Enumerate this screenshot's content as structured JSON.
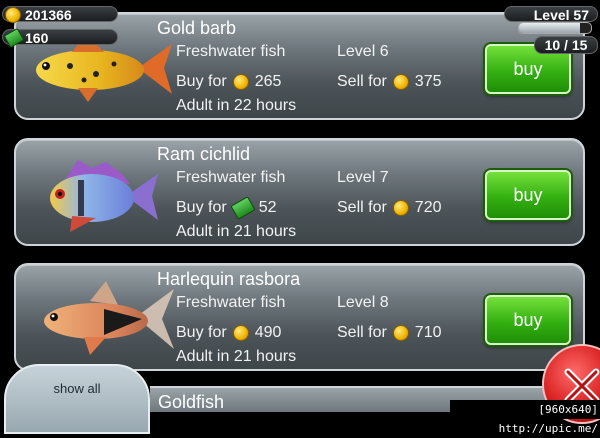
{
  "hud": {
    "coins": "201366",
    "cash": "160",
    "level": "Level 57",
    "progress": "10 / 15",
    "xp_fraction": 0.85
  },
  "fish_list": [
    {
      "name": "Gold barb",
      "type": "Freshwater fish",
      "level": "Level 6",
      "buy_label": "Buy for",
      "buy_currency": "coin",
      "buy_price": "265",
      "sell_label": "Sell for",
      "sell_price": "375",
      "adult": "Adult in 22 hours",
      "buy_button": "buy"
    },
    {
      "name": "Ram cichlid",
      "type": "Freshwater fish",
      "level": "Level 7",
      "buy_label": "Buy for",
      "buy_currency": "cash",
      "buy_price": "52",
      "sell_label": "Sell for",
      "sell_price": "720",
      "adult": "Adult in 21 hours",
      "buy_button": "buy"
    },
    {
      "name": "Harlequin rasbora",
      "type": "Freshwater fish",
      "level": "Level 8",
      "buy_label": "Buy for",
      "buy_currency": "coin",
      "buy_price": "490",
      "sell_label": "Sell for",
      "sell_price": "710",
      "adult": "Adult in 21 hours",
      "buy_button": "buy"
    }
  ],
  "next_fish_partial": "Goldfish",
  "show_all_label": "show all",
  "colors": {
    "buy_green": "#34b012",
    "close_red": "#d61c1c",
    "coin_gold": "#f0b400"
  },
  "watermark": "[960x640] http://upic.me/"
}
